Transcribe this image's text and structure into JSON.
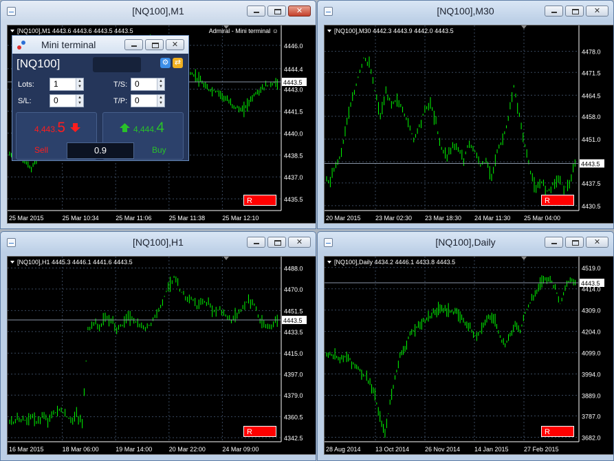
{
  "windows": [
    {
      "title": "[NQ100],M1",
      "header": "[NQ100],M1  4443.6 4443.6 4443.5 4443.5",
      "right_header": "Admiral - Mini terminal ☺",
      "price_labels": [
        "4446.0",
        "4444.4",
        "4443.0",
        "4441.5",
        "4440.0",
        "4438.5",
        "4437.0",
        "4435.5"
      ],
      "current_price": "4443.5",
      "time_labels": [
        "25 Mar 2015",
        "25 Mar 10:34",
        "25 Mar 11:06",
        "25 Mar 11:38",
        "25 Mar 12:10"
      ],
      "r_label": "R",
      "chart_data": {
        "type": "bar",
        "ylim": [
          4434.7,
          4446.7
        ],
        "series": [
          {
            "values": [
              4438.5,
              4437.5,
              4439.2,
              4440.6,
              4441.3,
              4442.0,
              4442.8,
              4444.0,
              4445.2,
              4446.2,
              4445.8,
              4446.3,
              4445.5,
              4444.6,
              4444.3,
              4443.9,
              4443.0,
              4442.8,
              4442.0,
              4441.5,
              4442.6,
              4443.2,
              4443.5
            ]
          }
        ]
      }
    },
    {
      "title": "[NQ100],M30",
      "header": "[NQ100],M30  4442.3 4443.9 4442.0 4443.5",
      "price_labels": [
        "4478.0",
        "4471.5",
        "4464.5",
        "4458.0",
        "4451.0",
        "4444.0",
        "4437.5",
        "4430.5"
      ],
      "current_price": "4443.5",
      "time_labels": [
        "20 Mar 2015",
        "23 Mar 02:30",
        "23 Mar 18:30",
        "24 Mar 11:30",
        "25 Mar 04:00"
      ],
      "r_label": "R",
      "chart_data": {
        "type": "bar",
        "ylim": [
          4429.0,
          4483.0
        ],
        "series": [
          {
            "values": [
              4438,
              4443,
              4447,
              4457,
              4463,
              4470,
              4476,
              4474,
              4466,
              4458,
              4465,
              4462,
              4463,
              4460,
              4456,
              4451,
              4455,
              4460,
              4462,
              4456,
              4448,
              4446,
              4449,
              4448,
              4445,
              4450,
              4447,
              4443,
              4444,
              4440,
              4447,
              4451,
              4457,
              4467,
              4458,
              4449,
              4441,
              4435,
              4438,
              4435,
              4437,
              4439,
              4436,
              4437,
              4443
            ]
          }
        ]
      }
    },
    {
      "title": "[NQ100],H1",
      "header": "[NQ100],H1  4445.3 4446.1 4441.6 4443.5",
      "price_labels": [
        "4488.0",
        "4470.0",
        "4451.5",
        "4433.5",
        "4415.0",
        "4397.0",
        "4379.0",
        "4360.5",
        "4342.5"
      ],
      "current_price": "4443.5",
      "time_labels": [
        "16 Mar 2015",
        "18 Mar 06:00",
        "19 Mar 14:00",
        "20 Mar 22:00",
        "24 Mar 09:00"
      ],
      "r_label": "R",
      "chart_data": {
        "type": "bar",
        "ylim": [
          4339.0,
          4489.5
        ],
        "series": [
          {
            "values": [
              4356,
              4359,
              4357,
              4361,
              4356,
              4360,
              4358,
              4363,
              4367,
              4362,
              4357,
              4362,
              4355,
              4435,
              4441,
              4437,
              4446,
              4443,
              4436,
              4439,
              4447,
              4443,
              4438,
              4436,
              4441,
              4449,
              4460,
              4472,
              4480,
              4469,
              4463,
              4462,
              4456,
              4459,
              4457,
              4451,
              4453,
              4447,
              4443,
              4449,
              4454,
              4461,
              4457,
              4442,
              4437,
              4439,
              4443
            ]
          }
        ]
      }
    },
    {
      "title": "[NQ100],Daily",
      "header": "[NQ100],Daily  4434.2 4446.1 4433.8 4443.5",
      "price_labels": [
        "4519.0",
        "4414.0",
        "4309.0",
        "4204.0",
        "4099.0",
        "3994.0",
        "3889.0",
        "3787.0",
        "3682.0"
      ],
      "current_price": "4443.5",
      "time_labels": [
        "28 Aug 2014",
        "13 Oct 2014",
        "26 Nov 2014",
        "14 Jan 2015",
        "27 Feb 2015"
      ],
      "r_label": "R",
      "chart_data": {
        "type": "bar",
        "ylim": [
          3660,
          4525
        ],
        "series": [
          {
            "values": [
              4092,
              4085,
              4075,
              4080,
              4062,
              4040,
              4010,
              3985,
              3950,
              3880,
              3775,
              3700,
              3850,
              3980,
              4080,
              4130,
              4185,
              4215,
              4240,
              4260,
              4280,
              4300,
              4320,
              4315,
              4305,
              4295,
              4280,
              4250,
              4220,
              4185,
              4205,
              4260,
              4275,
              4260,
              4180,
              4130,
              4190,
              4240,
              4205,
              4300,
              4345,
              4390,
              4440,
              4470,
              4460,
              4420,
              4340,
              4420,
              4455,
              4443
            ]
          }
        ]
      }
    }
  ],
  "mini_terminal": {
    "title": "Mini terminal",
    "symbol": "[NQ100]",
    "lots_label": "Lots:",
    "lots_value": "1",
    "sl_label": "S/L:",
    "sl_value": "0",
    "ts_label": "T/S:",
    "ts_value": "0",
    "tp_label": "T/P:",
    "tp_value": "0",
    "sell_price_small": "4,443.",
    "sell_price_big": "5",
    "buy_price_small": "4,444.",
    "buy_price_big": "4",
    "sell_label": "Sell",
    "buy_label": "Buy",
    "lot_display": "0.9",
    "colors": {
      "sell": "#ff1d1d",
      "buy": "#29c12a"
    }
  },
  "colors": {
    "candle": "#00ff00",
    "grid": "#3a4a60",
    "axis_text": "#ffffff",
    "price_tag_bg": "#ffffff",
    "r_button": "#ff0000"
  }
}
